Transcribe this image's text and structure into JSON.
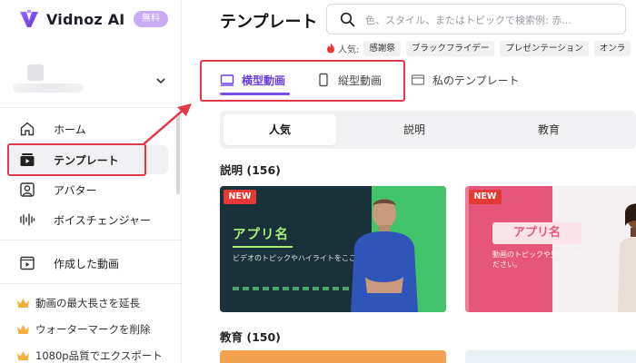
{
  "app": {
    "name": "Vidnoz AI",
    "plan_badge": "無料"
  },
  "sidebar": {
    "nav": [
      {
        "label": "ホーム",
        "icon": "home-icon"
      },
      {
        "label": "テンプレート",
        "icon": "template-icon",
        "active": true
      },
      {
        "label": "アバター",
        "icon": "avatar-icon"
      },
      {
        "label": "ボイスチェンジャー",
        "icon": "voice-wave-icon"
      },
      {
        "label": "作成した動画",
        "icon": "video-library-icon"
      }
    ],
    "upsell": [
      {
        "label": "動画の最大長さを延長",
        "icon": "crown-icon"
      },
      {
        "label": "ウォーターマークを削除",
        "icon": "crown-icon"
      },
      {
        "label": "1080p品質でエクスポート",
        "icon": "crown-icon"
      }
    ]
  },
  "header": {
    "title": "テンプレート",
    "search": {
      "placeholder": "色、スタイル、またはトピックで検索例: 赤...",
      "value": ""
    }
  },
  "hot_tags": {
    "label": "人気:",
    "tags": [
      "感謝祭",
      "ブラックフライデー",
      "プレゼンテーション",
      "オンラ"
    ]
  },
  "type_tabs": [
    {
      "label": "横型動画",
      "icon": "landscape-icon",
      "active": true
    },
    {
      "label": "縦型動画",
      "icon": "portrait-icon"
    },
    {
      "label": "私のテンプレート",
      "icon": "folder-icon"
    }
  ],
  "categories": [
    {
      "label": "人気",
      "active": true
    },
    {
      "label": "説明"
    },
    {
      "label": "教育"
    }
  ],
  "sections": [
    {
      "title": "説明 (156)",
      "cards": [
        {
          "badge": "NEW",
          "title": "アプリ名",
          "subtitle": "ビデオのトピックやハイライトをここに書く。"
        },
        {
          "badge": "NEW",
          "title": "アプリ名",
          "subtitle": "動画のトピックや見どころをご記入ください。"
        }
      ]
    },
    {
      "title": "教育 (150)"
    }
  ],
  "colors": {
    "accent": "#7b4de8",
    "callout": "#e23a4b",
    "new_badge": "#e53935"
  }
}
